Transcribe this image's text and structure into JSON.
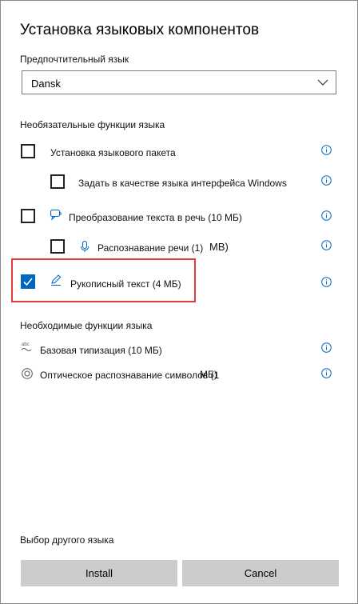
{
  "dialog": {
    "title": "Установка языковых компонентов",
    "preferred_label": "Предпочтительный язык",
    "language_value": "Dansk",
    "optional_label": "Необязательные функции языка",
    "required_label": "Необходимые функции языка",
    "choose_other_label": "Выбор другого языка",
    "accent_color": "#0067c0",
    "highlight_color": "#e03a3a"
  },
  "optional_features": {
    "language_pack": {
      "label": "Установка языкового пакета",
      "checked": false
    },
    "display_language": {
      "label": "Задать в качестве языка интерфейса Windows",
      "checked": false
    },
    "tts": {
      "label": "Преобразование текста в речь (10 МБ)",
      "checked": false,
      "icon": "text-to-speech-icon"
    },
    "speech": {
      "label": "Распознавание речи (1)",
      "suffix": "МВ)",
      "checked": false,
      "icon": "microphone-icon"
    },
    "handwriting": {
      "label": "Рукописный текст (4 МБ)",
      "checked": true,
      "icon": "pen-icon"
    }
  },
  "required_features": {
    "basic_typing": {
      "label": "Базовая типизация (10 МБ)",
      "icon": "abc-icon"
    },
    "ocr": {
      "label": "Оптическое распознавание символов (1",
      "overlay": "МБ)",
      "icon": "ocr-icon"
    }
  },
  "buttons": {
    "install": "Install",
    "cancel": "Cancel"
  }
}
